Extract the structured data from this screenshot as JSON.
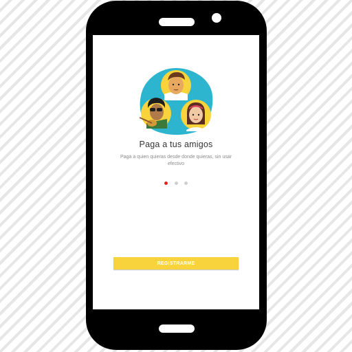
{
  "onboarding": {
    "title": "Paga a tus amigos",
    "subtitle": "Paga a quien quieras desde donde quieras, sin usar efectivo",
    "page_indicator": {
      "total": 3,
      "current": 1
    },
    "register_button_label": "REGISTRARME",
    "illustration_icon": "friends-group-icon"
  },
  "colors": {
    "accent_yellow": "#f9d33b",
    "indicator_active": "#e0261f",
    "indicator_inactive": "#cfcfcf",
    "illustration_teal": "#2db5cf"
  }
}
